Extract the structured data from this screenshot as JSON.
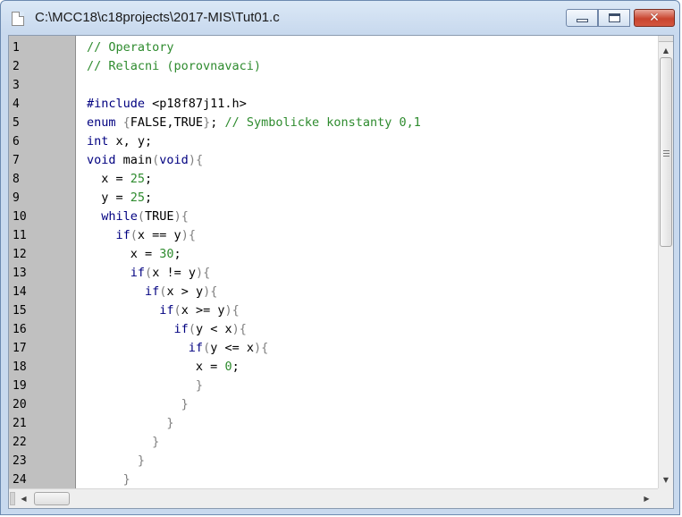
{
  "window": {
    "title": "C:\\MCC18\\c18projects\\2017-MIS\\Tut01.c",
    "controls": {
      "minimize": "minimize",
      "maximize": "maximize",
      "close": "✕"
    }
  },
  "editor": {
    "line_numbers": [
      "1",
      "2",
      "3",
      "4",
      "5",
      "6",
      "7",
      "8",
      "9",
      "10",
      "11",
      "12",
      "13",
      "14",
      "15",
      "16",
      "17",
      "18",
      "19",
      "20",
      "21",
      "22",
      "23",
      "24"
    ],
    "lines": [
      [
        {
          "t": "// Operatory",
          "c": "cm"
        }
      ],
      [
        {
          "t": "// Relacni (porovnavaci)",
          "c": "cm"
        }
      ],
      [],
      [
        {
          "t": "#include ",
          "c": "kw"
        },
        {
          "t": "<p18f87j11.h>",
          "c": ""
        }
      ],
      [
        {
          "t": "enum ",
          "c": "kw"
        },
        {
          "t": "{",
          "c": "br"
        },
        {
          "t": "FALSE,TRUE",
          "c": ""
        },
        {
          "t": "}",
          "c": "br"
        },
        {
          "t": "; ",
          "c": ""
        },
        {
          "t": "// Symbolicke konstanty 0,1",
          "c": "cm"
        }
      ],
      [
        {
          "t": "int ",
          "c": "kw"
        },
        {
          "t": "x, y;",
          "c": ""
        }
      ],
      [
        {
          "t": "void ",
          "c": "kw"
        },
        {
          "t": "main",
          "c": ""
        },
        {
          "t": "(",
          "c": "br"
        },
        {
          "t": "void",
          "c": "kw"
        },
        {
          "t": ")",
          "c": "br"
        },
        {
          "t": "{",
          "c": "br"
        }
      ],
      [
        {
          "t": "  x = ",
          "c": ""
        },
        {
          "t": "25",
          "c": "num"
        },
        {
          "t": ";",
          "c": ""
        }
      ],
      [
        {
          "t": "  y = ",
          "c": ""
        },
        {
          "t": "25",
          "c": "num"
        },
        {
          "t": ";",
          "c": ""
        }
      ],
      [
        {
          "t": "  ",
          "c": ""
        },
        {
          "t": "while",
          "c": "kw"
        },
        {
          "t": "(",
          "c": "br"
        },
        {
          "t": "TRUE",
          "c": ""
        },
        {
          "t": ")",
          "c": "br"
        },
        {
          "t": "{",
          "c": "br"
        }
      ],
      [
        {
          "t": "    ",
          "c": ""
        },
        {
          "t": "if",
          "c": "kw"
        },
        {
          "t": "(",
          "c": "br"
        },
        {
          "t": "x == y",
          "c": ""
        },
        {
          "t": ")",
          "c": "br"
        },
        {
          "t": "{",
          "c": "br"
        }
      ],
      [
        {
          "t": "      x = ",
          "c": ""
        },
        {
          "t": "30",
          "c": "num"
        },
        {
          "t": ";",
          "c": ""
        }
      ],
      [
        {
          "t": "      ",
          "c": ""
        },
        {
          "t": "if",
          "c": "kw"
        },
        {
          "t": "(",
          "c": "br"
        },
        {
          "t": "x != y",
          "c": ""
        },
        {
          "t": ")",
          "c": "br"
        },
        {
          "t": "{",
          "c": "br"
        }
      ],
      [
        {
          "t": "        ",
          "c": ""
        },
        {
          "t": "if",
          "c": "kw"
        },
        {
          "t": "(",
          "c": "br"
        },
        {
          "t": "x > y",
          "c": ""
        },
        {
          "t": ")",
          "c": "br"
        },
        {
          "t": "{",
          "c": "br"
        }
      ],
      [
        {
          "t": "          ",
          "c": ""
        },
        {
          "t": "if",
          "c": "kw"
        },
        {
          "t": "(",
          "c": "br"
        },
        {
          "t": "x >= y",
          "c": ""
        },
        {
          "t": ")",
          "c": "br"
        },
        {
          "t": "{",
          "c": "br"
        }
      ],
      [
        {
          "t": "            ",
          "c": ""
        },
        {
          "t": "if",
          "c": "kw"
        },
        {
          "t": "(",
          "c": "br"
        },
        {
          "t": "y < x",
          "c": ""
        },
        {
          "t": ")",
          "c": "br"
        },
        {
          "t": "{",
          "c": "br"
        }
      ],
      [
        {
          "t": "              ",
          "c": ""
        },
        {
          "t": "if",
          "c": "kw"
        },
        {
          "t": "(",
          "c": "br"
        },
        {
          "t": "y <= x",
          "c": ""
        },
        {
          "t": ")",
          "c": "br"
        },
        {
          "t": "{",
          "c": "br"
        }
      ],
      [
        {
          "t": "               x = ",
          "c": ""
        },
        {
          "t": "0",
          "c": "num"
        },
        {
          "t": ";",
          "c": ""
        }
      ],
      [
        {
          "t": "               }",
          "c": "br"
        }
      ],
      [
        {
          "t": "             }",
          "c": "br"
        }
      ],
      [
        {
          "t": "           }",
          "c": "br"
        }
      ],
      [
        {
          "t": "         }",
          "c": "br"
        }
      ],
      [
        {
          "t": "       }",
          "c": "br"
        }
      ],
      [
        {
          "t": "     }",
          "c": "br"
        }
      ]
    ]
  },
  "colors": {
    "keyword": "#000080",
    "comment": "#2e8b2e",
    "number": "#2e8b2e",
    "brace": "#808080",
    "gutter": "#c0c0c0"
  },
  "scrollbars": {
    "vertical_icons": {
      "up": "arrow-up-icon",
      "down": "arrow-down-icon"
    },
    "horizontal_icons": {
      "left": "arrow-left-icon",
      "right": "arrow-right-icon"
    }
  }
}
